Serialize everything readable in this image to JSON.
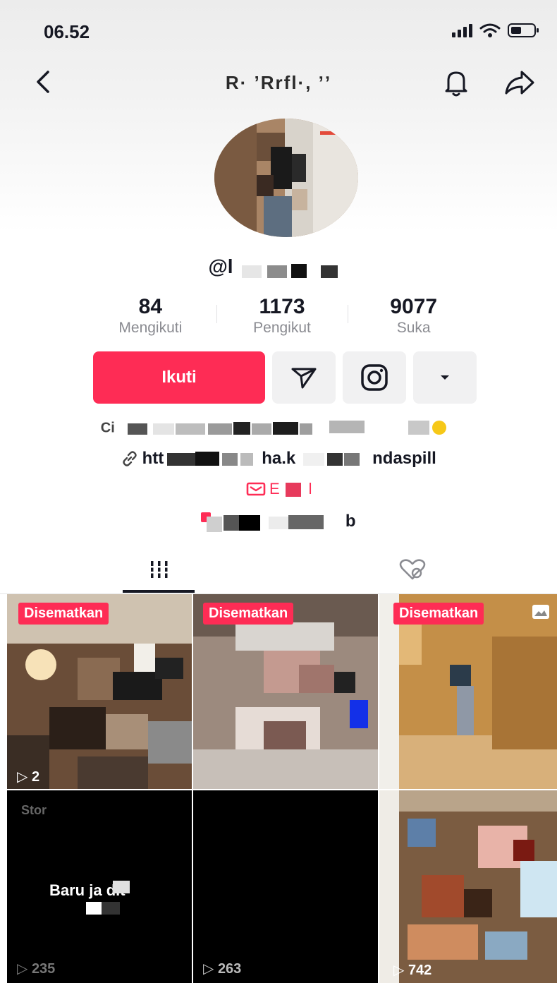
{
  "status_bar": {
    "time": "06.52"
  },
  "nav": {
    "title": "R· ’Rrfl·, ʼʼ",
    "icons": [
      "back-icon",
      "bell-icon",
      "share-icon"
    ]
  },
  "profile": {
    "username": "@l",
    "stats": [
      {
        "value": "84",
        "label": "Mengikuti"
      },
      {
        "value": "1173",
        "label": "Pengikut"
      },
      {
        "value": "9077",
        "label": "Suka"
      }
    ],
    "follow_label": "Ikuti",
    "bio": {
      "line1_prefix": "Ci",
      "link_prefix": "htt",
      "link_mid": "ha.k",
      "link_suffix": "ndaspill",
      "email_prefix": "E",
      "email_suffix": "l",
      "contact_suffix": "b"
    }
  },
  "tabs": [
    {
      "name": "videos",
      "icon": "grid-icon",
      "active": true
    },
    {
      "name": "liked",
      "icon": "hidden-heart-icon",
      "active": false
    }
  ],
  "videos": [
    {
      "badge": "Disematkan",
      "views": "2"
    },
    {
      "badge": "Disematkan",
      "views": ""
    },
    {
      "badge": "Disematkan",
      "views": ""
    },
    {
      "caption_top": "Stor",
      "caption": "Baru ja dit",
      "views": "235"
    },
    {
      "views": "263"
    },
    {
      "views": "742"
    }
  ],
  "colors": {
    "accent": "#fe2c55",
    "text": "#161823",
    "muted": "#8a8b91"
  }
}
